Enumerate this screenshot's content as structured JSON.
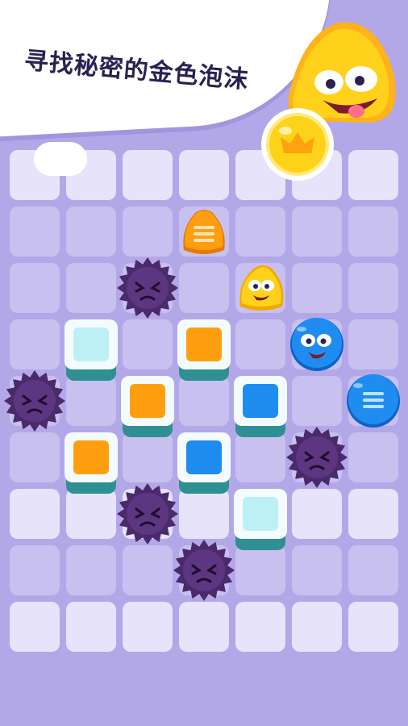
{
  "banner": {
    "text": "寻找秘密的金色泡沫"
  },
  "board": {
    "cols": 7,
    "rows": 9,
    "tile_color": "#c8c1f0",
    "tile_light_color": "#e7e3fb",
    "background": "#b2a8e8"
  },
  "pieces": [
    {
      "kind": "blob-orange",
      "col": 3,
      "row": 3
    },
    {
      "kind": "blob-yellow",
      "col": 4,
      "row": 4
    },
    {
      "kind": "blob-blue",
      "col": 5,
      "row": 5
    },
    {
      "kind": "blob-blue-striped",
      "col": 6,
      "row": 6
    },
    {
      "kind": "spiky",
      "col": 2,
      "row": 4
    },
    {
      "kind": "spiky",
      "col": 0,
      "row": 6
    },
    {
      "kind": "spiky",
      "col": 5,
      "row": 7
    },
    {
      "kind": "spiky",
      "col": 2,
      "row": 8
    },
    {
      "kind": "spiky",
      "col": 3,
      "row": 9
    },
    {
      "kind": "block-cyan",
      "col": 1,
      "row": 5
    },
    {
      "kind": "block-orange",
      "col": 3,
      "row": 5
    },
    {
      "kind": "block-orange",
      "col": 2,
      "row": 6
    },
    {
      "kind": "block-blue",
      "col": 4,
      "row": 6
    },
    {
      "kind": "block-orange",
      "col": 1,
      "row": 7
    },
    {
      "kind": "block-blue",
      "col": 3,
      "row": 7
    },
    {
      "kind": "block-cyan",
      "col": 4,
      "row": 8
    }
  ],
  "colors": {
    "orange": "#ff9f0f",
    "yellow": "#ffd11a",
    "blue": "#1f8df0",
    "cyan": "#bdf0f5",
    "teal_base": "#2f8f93",
    "spiky": "#4a2a6b"
  },
  "icons": {
    "mascot": "yellow-blob-mascot-icon",
    "golden_bubble": "crown-bubble-icon"
  }
}
